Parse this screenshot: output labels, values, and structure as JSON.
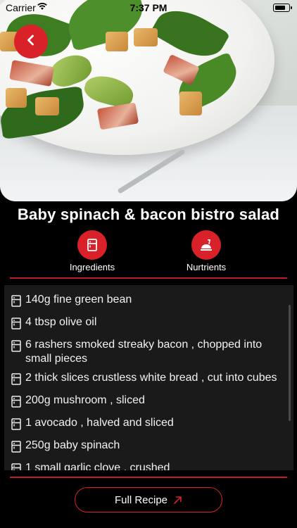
{
  "status_bar": {
    "carrier": "Carrier",
    "time": "7:37 PM"
  },
  "hero": {
    "image": "spinach-bacon-salad-photo",
    "back_icon": "chevron-left-icon"
  },
  "recipe": {
    "title": "Baby spinach & bacon bistro salad"
  },
  "tabs": [
    {
      "label": "Ingredients",
      "icon": "fridge-icon"
    },
    {
      "label": "Nurtrients",
      "icon": "food-tray-icon"
    }
  ],
  "ingredients": [
    "140g fine green bean",
    "4 tbsp olive oil",
    "6 rashers smoked streaky bacon , chopped into small pieces",
    "2 thick slices crustless white bread , cut into cubes",
    "200g mushroom , sliced",
    "1 avocado , halved and sliced",
    "250g baby spinach",
    "1 small garlic clove , crushed"
  ],
  "full_recipe_button": {
    "label": "Full Recipe",
    "icon": "arrow-up-right-icon"
  },
  "colors": {
    "accent": "#d9212a",
    "background": "#000000",
    "panel": "#1a1a1a"
  }
}
